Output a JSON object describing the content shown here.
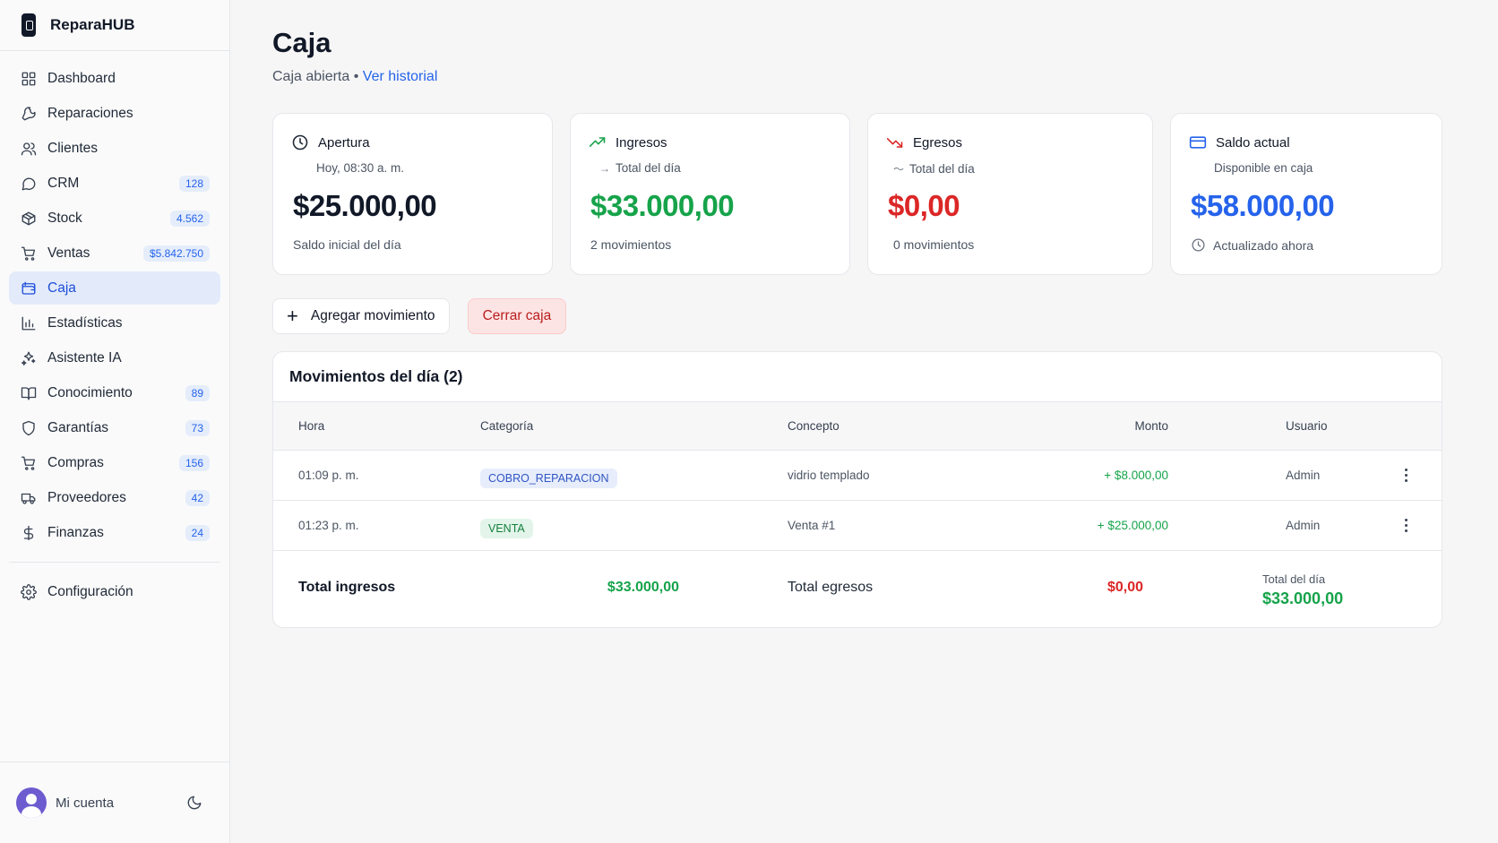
{
  "brand": {
    "name": "ReparaHUB"
  },
  "sidebar": {
    "items": [
      {
        "label": "Dashboard",
        "icon": "grid-icon",
        "badge": null
      },
      {
        "label": "Reparaciones",
        "icon": "wrench-icon",
        "badge": null
      },
      {
        "label": "Clientes",
        "icon": "users-icon",
        "badge": null
      },
      {
        "label": "CRM",
        "icon": "chat-icon",
        "badge": "128"
      },
      {
        "label": "Stock",
        "icon": "box-icon",
        "badge": "4.562"
      },
      {
        "label": "Ventas",
        "icon": "cart-icon",
        "badge": "$5.842.750"
      },
      {
        "label": "Caja",
        "icon": "wallet-icon",
        "badge": null,
        "active": true
      },
      {
        "label": "Estadísticas",
        "icon": "bar-chart-icon",
        "badge": null
      },
      {
        "label": "Asistente IA",
        "icon": "sparkles-icon",
        "badge": null
      },
      {
        "label": "Conocimiento",
        "icon": "book-icon",
        "badge": "89"
      },
      {
        "label": "Garantías",
        "icon": "shield-icon",
        "badge": "73"
      },
      {
        "label": "Compras",
        "icon": "cart-icon",
        "badge": "156"
      },
      {
        "label": "Proveedores",
        "icon": "truck-icon",
        "badge": "42"
      },
      {
        "label": "Finanzas",
        "icon": "dollar-icon",
        "badge": "24"
      }
    ],
    "settings_label": "Configuración",
    "account_label": "Mi cuenta"
  },
  "page": {
    "title": "Caja",
    "status": "Caja abierta",
    "history_link": "Ver historial"
  },
  "cards": {
    "apertura": {
      "title": "Apertura",
      "sub": "Hoy, 08:30 a. m.",
      "value": "$25.000,00",
      "foot": "Saldo inicial del día"
    },
    "ingresos": {
      "title": "Ingresos",
      "sub": "Total del día",
      "value": "$33.000,00",
      "foot": "2 movimientos"
    },
    "egresos": {
      "title": "Egresos",
      "sub": "Total del día",
      "value": "$0,00",
      "foot": "0 movimientos"
    },
    "saldo": {
      "title": "Saldo actual",
      "sub": "Disponible en caja",
      "value": "$58.000,00",
      "foot": "Actualizado ahora"
    }
  },
  "actions": {
    "add_label": "Agregar movimiento",
    "close_label": "Cerrar caja"
  },
  "table": {
    "title": "Movimientos del día (2)",
    "headers": {
      "hora": "Hora",
      "categoria": "Categoría",
      "concepto": "Concepto",
      "monto": "Monto",
      "usuario": "Usuario"
    },
    "rows": [
      {
        "hora": "01:09 p. m.",
        "categoria": "COBRO_REPARACION",
        "concepto": "vidrio templado",
        "monto": "+ $8.000,00",
        "usuario": "Admin"
      },
      {
        "hora": "01:23 p. m.",
        "categoria": "VENTA",
        "concepto": "Venta #1",
        "monto": "+ $25.000,00",
        "usuario": "Admin"
      }
    ],
    "totals": {
      "ingresos_label": "Total ingresos",
      "ingresos_value": "$33.000,00",
      "egresos_label": "Total egresos",
      "egresos_value": "$0,00",
      "dia_label": "Total del día",
      "dia_value": "$33.000,00"
    }
  },
  "colors": {
    "accent": "#2563eb",
    "income": "#16a34a",
    "expense": "#dc2626",
    "balance": "#2563eb"
  }
}
